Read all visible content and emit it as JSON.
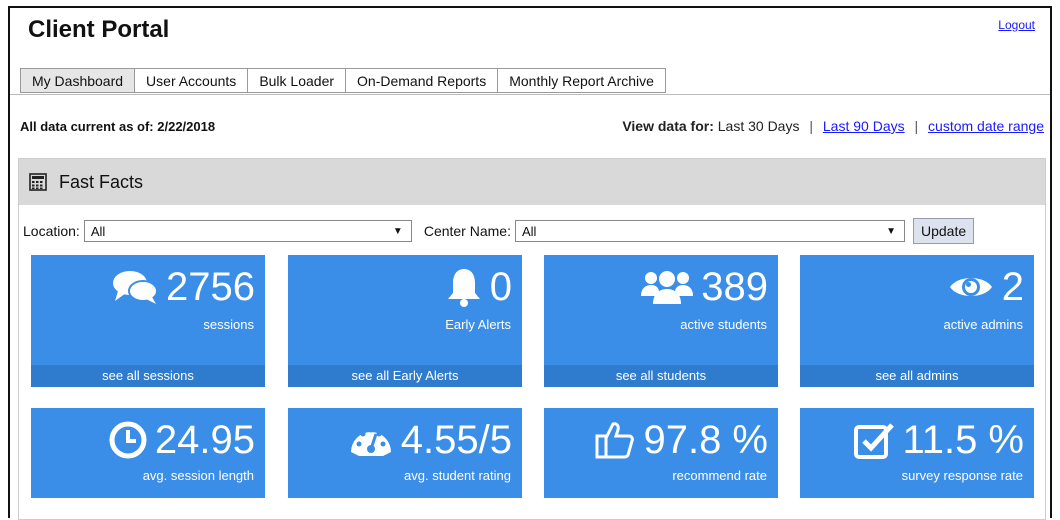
{
  "header": {
    "title": "Client Portal",
    "logout": "Logout"
  },
  "tabs": [
    {
      "label": "My Dashboard"
    },
    {
      "label": "User Accounts"
    },
    {
      "label": "Bulk Loader"
    },
    {
      "label": "On-Demand Reports"
    },
    {
      "label": "Monthly Report Archive"
    }
  ],
  "status": {
    "as_of": "All data current as of: 2/22/2018",
    "view_label": "View data for:",
    "current_range": "Last 30 Days",
    "sep": "|",
    "link_90": "Last 90 Days",
    "link_custom": "custom date range"
  },
  "panel": {
    "title": "Fast Facts"
  },
  "filters": {
    "location_label": "Location:",
    "location_value": "All",
    "center_label": "Center Name:",
    "center_value": "All",
    "update_label": "Update",
    "arrow": "▼"
  },
  "tiles": [
    {
      "value": "2756",
      "label": "sessions",
      "link": "see all sessions",
      "icon": "chat-icon"
    },
    {
      "value": "0",
      "label": "Early Alerts",
      "link": "see all Early Alerts",
      "icon": "bell-icon"
    },
    {
      "value": "389",
      "label": "active students",
      "link": "see all students",
      "icon": "users-icon"
    },
    {
      "value": "2",
      "label": "active admins",
      "link": "see all admins",
      "icon": "eye-icon"
    },
    {
      "value": "24.95",
      "label": "avg. session length",
      "icon": "clock-icon"
    },
    {
      "value": "4.55/5",
      "label": "avg. student rating",
      "icon": "gauge-icon"
    },
    {
      "value": "97.8 %",
      "label": "recommend rate",
      "icon": "thumbs-up-icon"
    },
    {
      "value": "11.5 %",
      "label": "survey response rate",
      "icon": "check-square-icon"
    }
  ],
  "colors": {
    "tile": "#3b8ee8",
    "tile_footer": "#2f7ccf",
    "link": "#1a1aff",
    "panel_header": "#d9d9d9"
  }
}
